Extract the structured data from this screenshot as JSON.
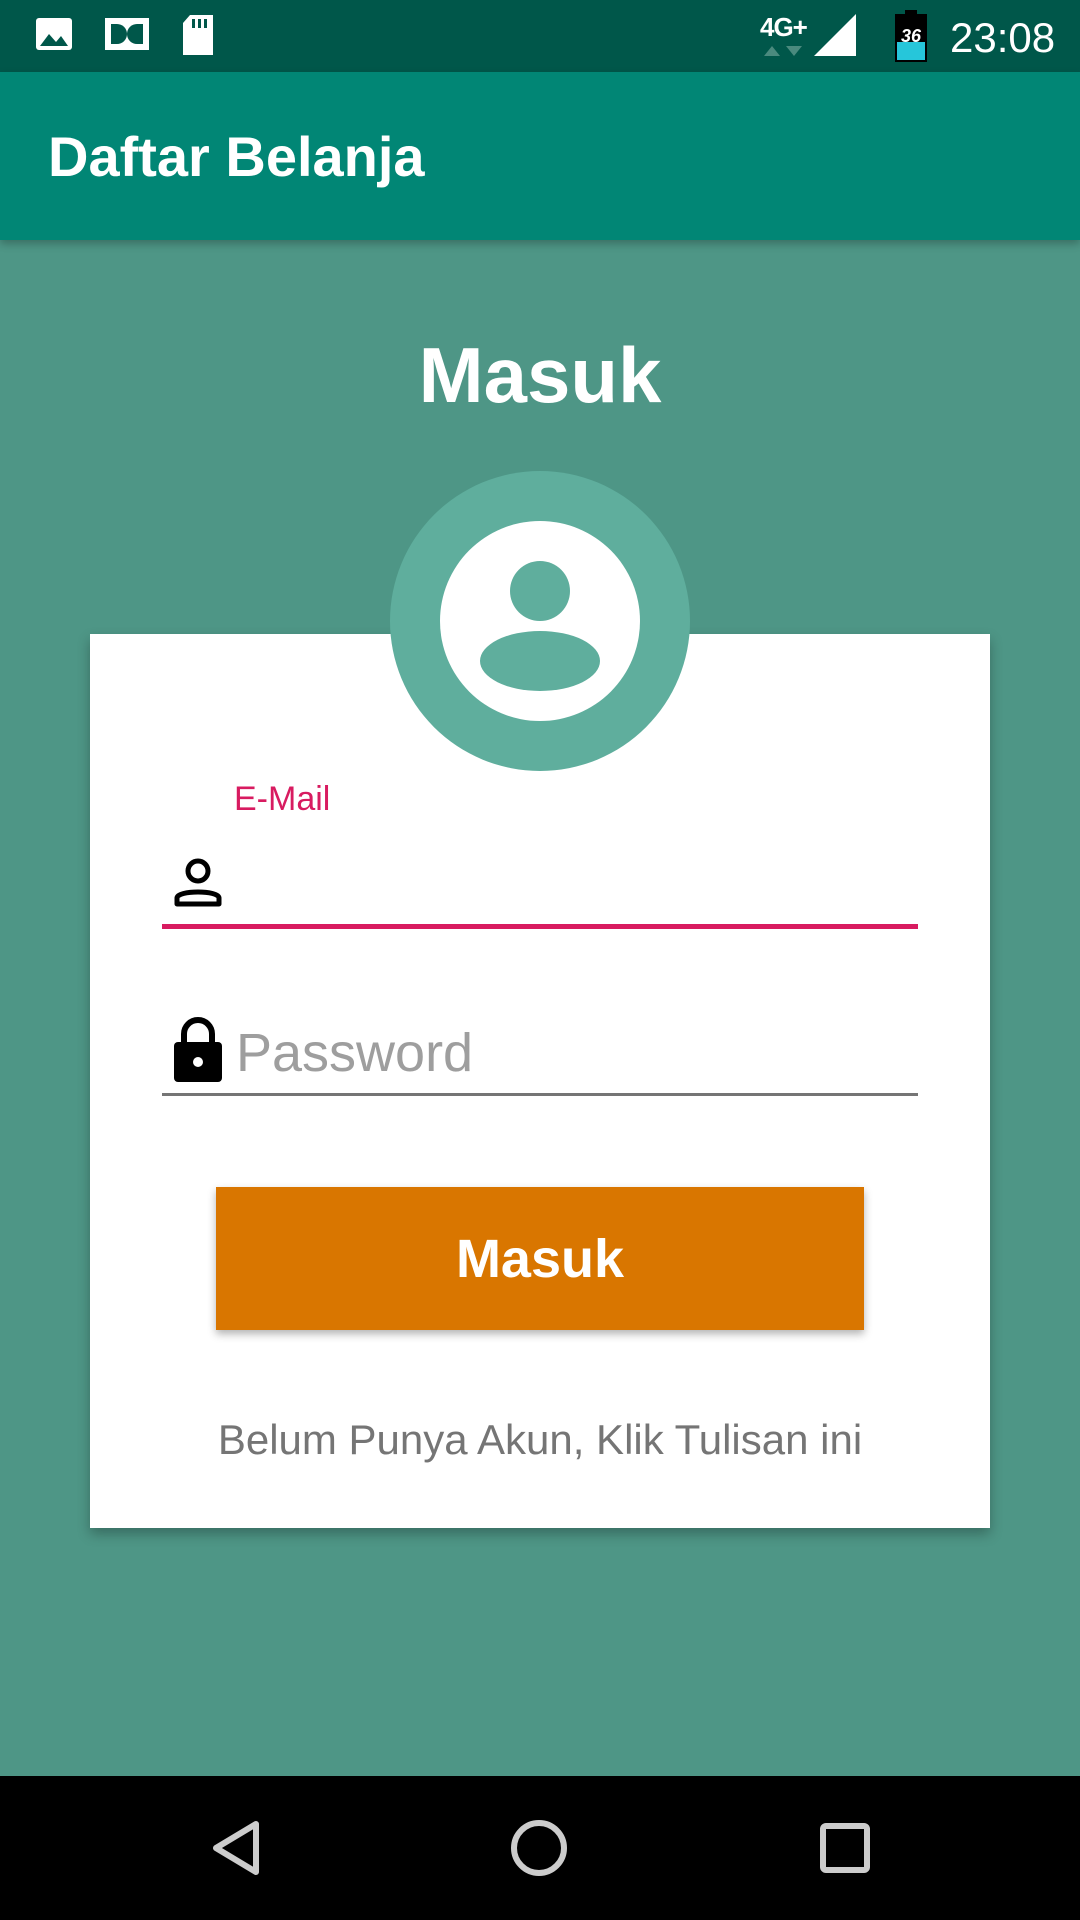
{
  "status_bar": {
    "network": "4G+",
    "battery": "36",
    "time": "23:08",
    "icons": [
      "gallery-icon",
      "dolby-icon",
      "sd-card-icon",
      "signal-icon",
      "battery-icon"
    ]
  },
  "app_bar": {
    "title": "Daftar Belanja"
  },
  "login": {
    "heading": "Masuk",
    "email_label": "E-Mail",
    "email_value": "",
    "password_placeholder": "Password",
    "button_label": "Masuk",
    "register_link": "Belum Punya Akun, Klik Tulisan ini"
  },
  "colors": {
    "status_bar": "#00574a",
    "app_bar": "#018675",
    "background": "#4e9686",
    "avatar": "#5fae9d",
    "accent": "#d81b60",
    "button": "#d97600"
  },
  "nav_bar": {
    "icons": [
      "back-icon",
      "home-icon",
      "recents-icon"
    ]
  }
}
